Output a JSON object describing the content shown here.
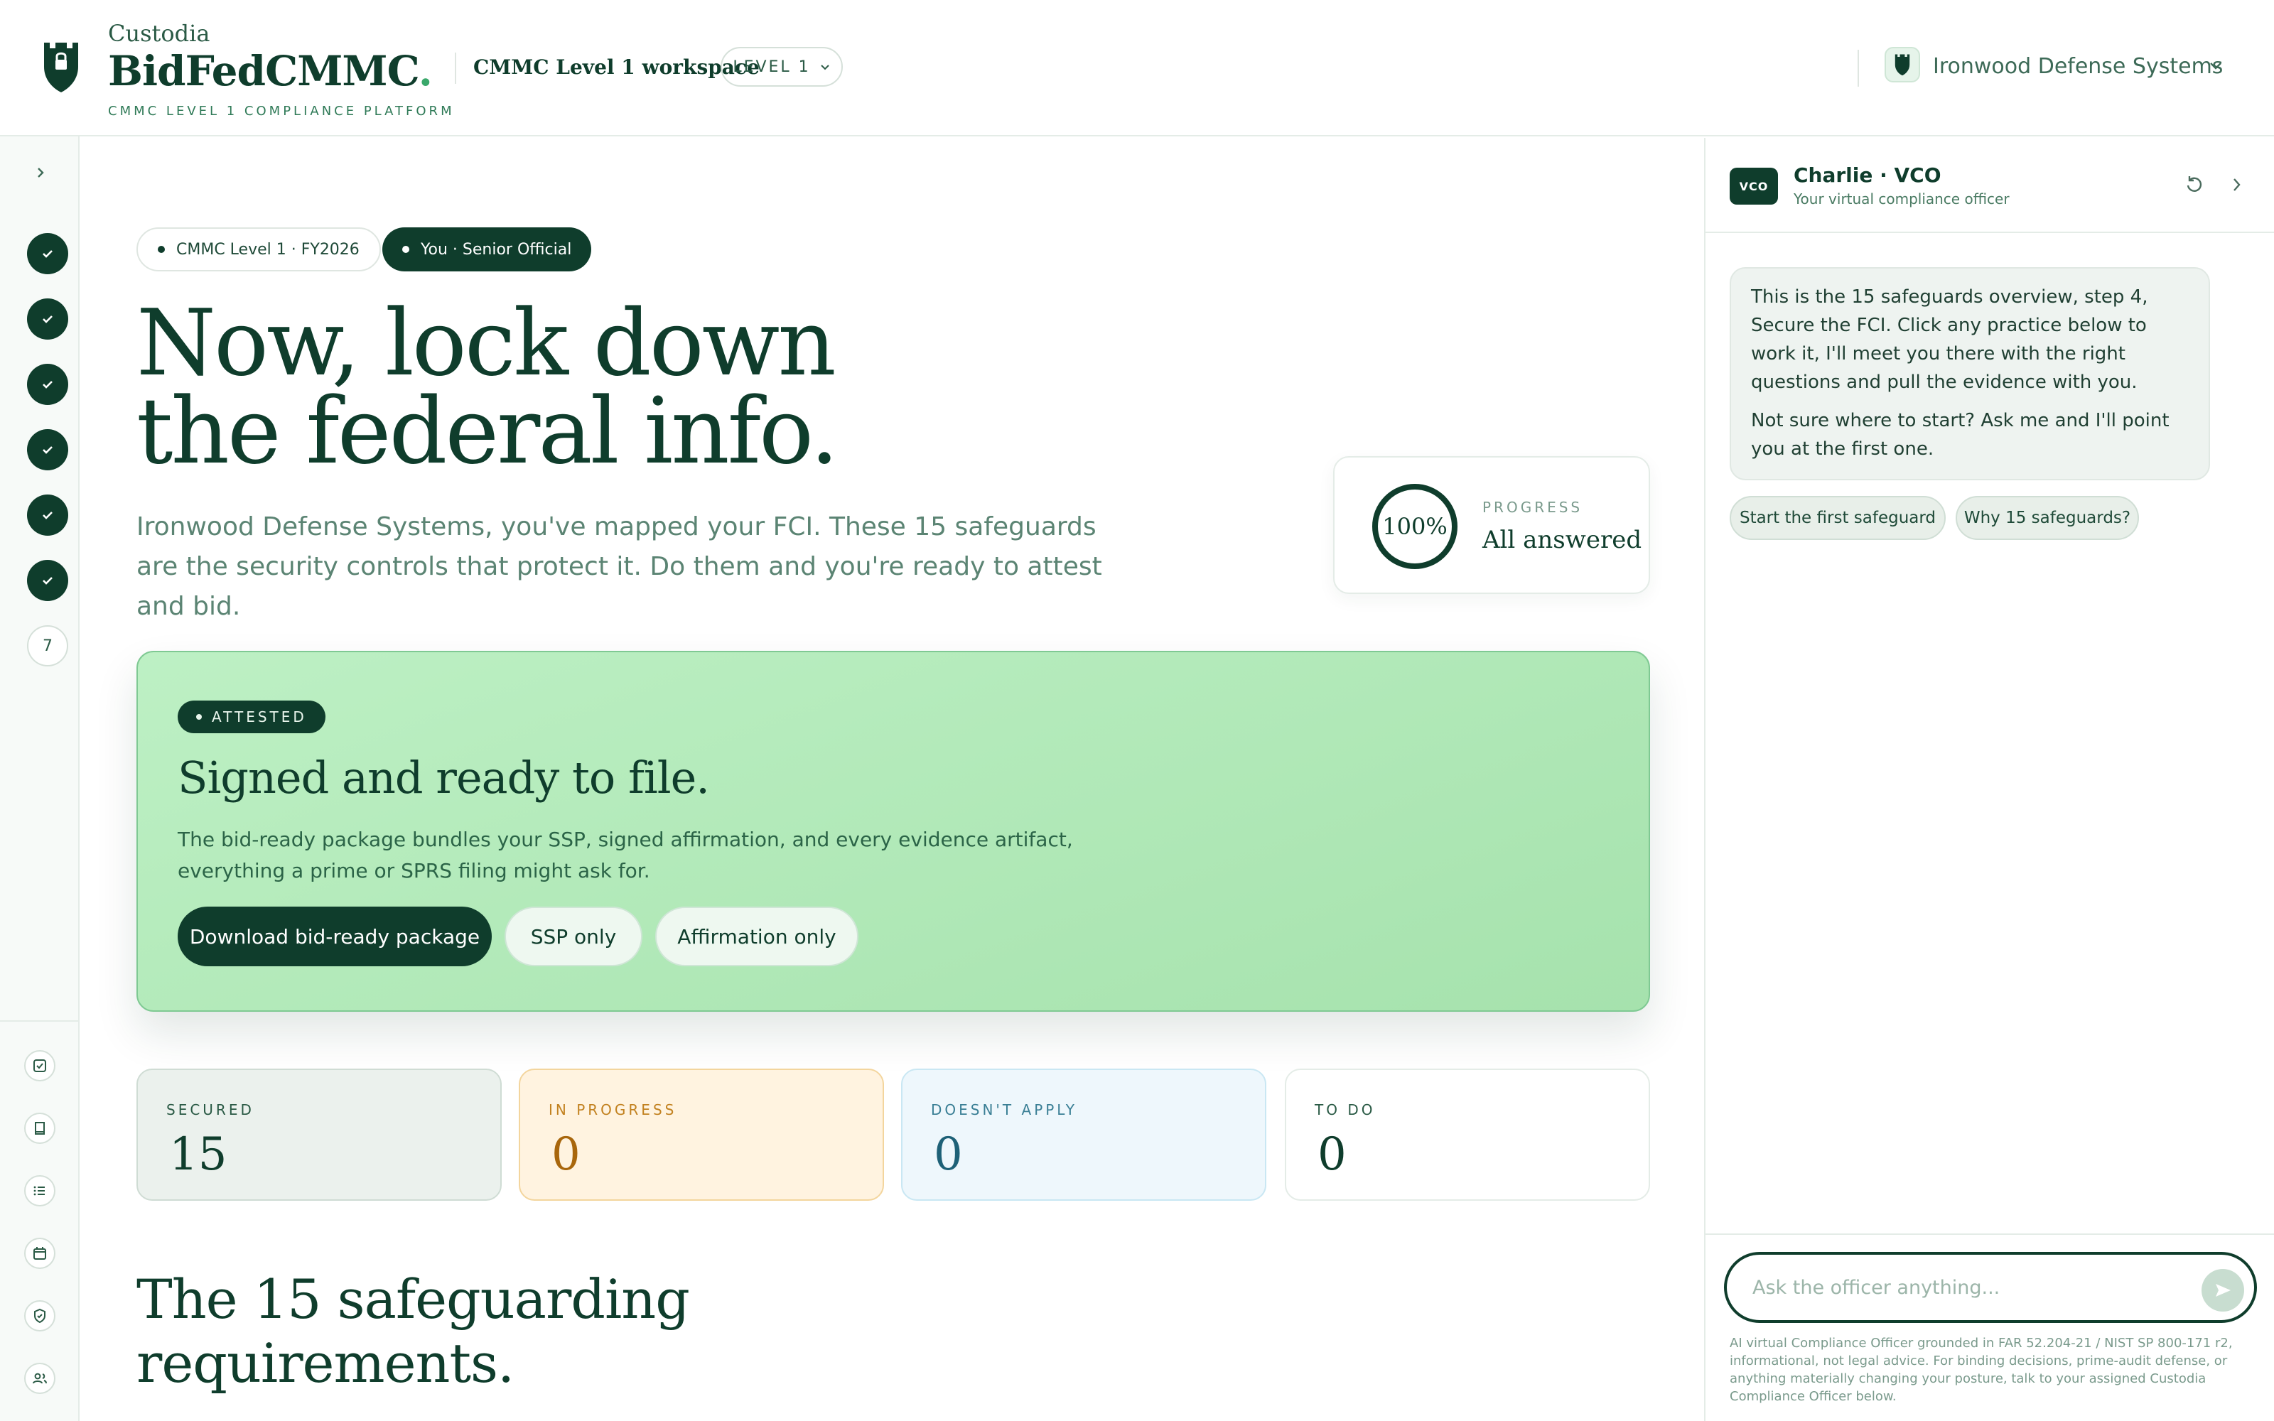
{
  "header": {
    "brand_small": "Custodia",
    "brand_big": "BidFedCMMC",
    "brand_dot": ".",
    "tagline": "CMMC LEVEL 1 COMPLIANCE PLATFORM",
    "workspace": "CMMC Level 1 workspace",
    "level_pill": "LEVEL 1",
    "org_name": "Ironwood Defense Systems"
  },
  "rail": {
    "completed_steps": 6,
    "current_step_label": "7",
    "tools": [
      "checklist-icon",
      "book-icon",
      "list-icon",
      "calendar-icon",
      "shield-icon",
      "users-icon"
    ]
  },
  "main": {
    "chip_level": "CMMC Level 1 · FY2026",
    "chip_you": "You · Senior Official",
    "hero_title_line1": "Now, lock down",
    "hero_title_line2": "the federal info.",
    "hero_sub": "Ironwood Defense Systems, you've mapped your FCI. These 15 safeguards are the security controls that protect it. Do them and you're ready to attest and bid.",
    "progress": {
      "percent_label": "100%",
      "percent": 100,
      "label": "PROGRESS",
      "status": "All answered"
    },
    "attest": {
      "badge": "ATTESTED",
      "title": "Signed and ready to file.",
      "desc": "The bid-ready package bundles your SSP, signed affirmation, and every evidence artifact, everything a prime or SPRS filing might ask for.",
      "btn_download": "Download bid-ready package",
      "btn_ssp": "SSP only",
      "btn_affirm": "Affirmation only"
    },
    "stats": {
      "secured": {
        "label": "SECURED",
        "value": "15"
      },
      "in_progress": {
        "label": "IN PROGRESS",
        "value": "0"
      },
      "na": {
        "label": "DOESN'T APPLY",
        "value": "0"
      },
      "todo": {
        "label": "TO DO",
        "value": "0"
      }
    },
    "section_title_line1": "The 15 safeguarding",
    "section_title_line2": "requirements."
  },
  "panel": {
    "badge": "VCO",
    "name": "Charlie · VCO",
    "role": "Your virtual compliance officer",
    "message_p1": "This is the 15 safeguards overview, step 4, Secure the FCI. Click any practice below to work it, I'll meet you there with the right questions and pull the evidence with you.",
    "message_p2": "Not sure where to start? Ask me and I'll point you at the first one.",
    "suggestion_1": "Start the first safeguard",
    "suggestion_2": "Why 15 safeguards?",
    "composer_placeholder": "Ask the officer anything...",
    "disclaimer": "AI virtual Compliance Officer grounded in FAR 52.204-21 / NIST SP 800-171 r2, informational, not legal advice. For binding decisions, prime-audit defense, or anything materially changing your posture, talk to your assigned Custodia Compliance Officer below."
  },
  "colors": {
    "brand": "#0f3d2c",
    "accent_green": "#3aa86b",
    "attest_bg": "#b6ecbe",
    "in_progress": "#a8660c",
    "not_applicable": "#1e6177"
  }
}
